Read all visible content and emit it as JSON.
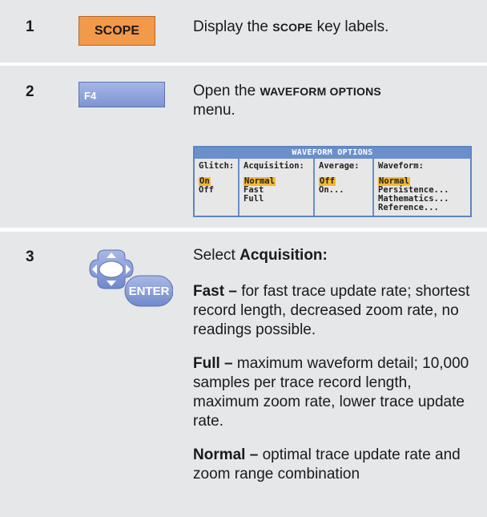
{
  "steps": [
    {
      "number": "1",
      "key": "SCOPE",
      "text_before": "Display the ",
      "text_key": "SCOPE",
      "text_after": " key labels."
    },
    {
      "number": "2",
      "key": "F4",
      "text_before": "Open the ",
      "text_key": "WAVEFORM OPTIONS",
      "text_after": " menu."
    },
    {
      "number": "3",
      "key": "ENTER",
      "heading_plain": "Select ",
      "heading_bold": "Acquisition:",
      "items": [
        {
          "term": "Fast –",
          "desc": " for fast trace update rate; shortest record length, decreased zoom rate, no readings possible."
        },
        {
          "term": "Full –",
          "desc": " maximum waveform detail; 10,000 samples per trace record length, maximum zoom rate, lower trace update rate."
        },
        {
          "term": "Normal –",
          "desc": " optimal trace update rate and zoom range combination"
        }
      ]
    }
  ],
  "menu": {
    "title": "WAVEFORM OPTIONS",
    "columns": [
      {
        "header": "Glitch:",
        "options": [
          "On",
          "Off"
        ],
        "selected": "On"
      },
      {
        "header": "Acquisition:",
        "options": [
          "Normal",
          "Fast",
          "Full"
        ],
        "selected": "Normal"
      },
      {
        "header": "Average:",
        "options": [
          "Off",
          "On..."
        ],
        "selected": "Off"
      },
      {
        "header": "Waveform:",
        "options": [
          "Normal",
          "Persistence...",
          "Mathematics...",
          "Reference..."
        ],
        "selected": "Normal"
      }
    ]
  },
  "colors": {
    "row_background": "#e6e7e8",
    "scope_key": "#f2994a",
    "f4_key": "#7e95d3",
    "menu_title": "#6a8fcb",
    "menu_selection": "#f5b82e",
    "nav_key": "#7e95d3"
  }
}
